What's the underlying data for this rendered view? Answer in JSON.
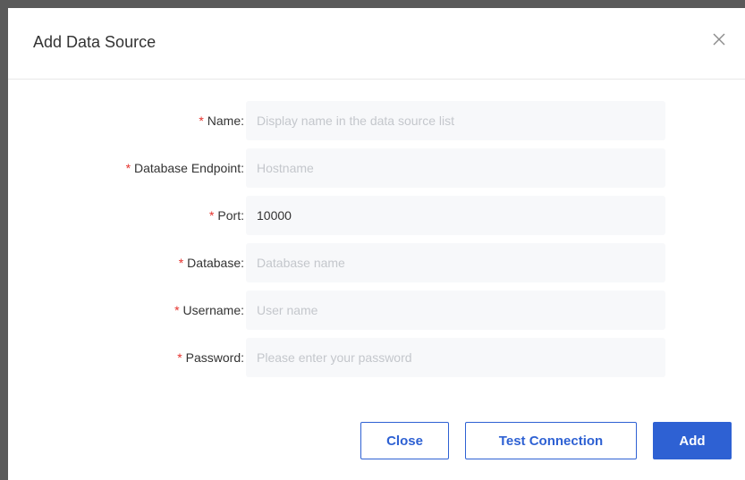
{
  "dialog": {
    "title": "Add Data Source",
    "close_icon": "close-icon"
  },
  "form": {
    "required_marker": "*",
    "fields": [
      {
        "label": "Name:",
        "value": "",
        "placeholder": "Display name in the data source list"
      },
      {
        "label": "Database Endpoint:",
        "value": "",
        "placeholder": "Hostname"
      },
      {
        "label": "Port:",
        "value": "10000",
        "placeholder": ""
      },
      {
        "label": "Database:",
        "value": "",
        "placeholder": "Database name"
      },
      {
        "label": "Username:",
        "value": "",
        "placeholder": "User name"
      },
      {
        "label": "Password:",
        "value": "",
        "placeholder": "Please enter your password"
      }
    ]
  },
  "buttons": {
    "close_label": "Close",
    "test_label": "Test Connection",
    "add_label": "Add"
  },
  "colors": {
    "accent": "#2e61d3",
    "required": "#e5322d",
    "input_bg": "#f7f8fa"
  }
}
